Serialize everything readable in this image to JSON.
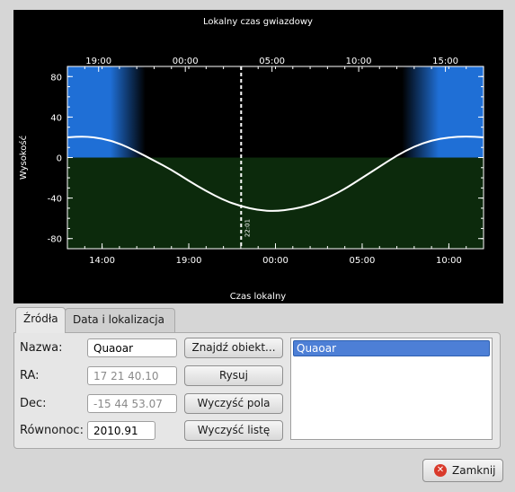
{
  "chart_data": {
    "type": "line",
    "title": "Lokalny czas gwiazdowy",
    "xlabel": "Czas lokalny",
    "ylabel": "Wysokość",
    "top_ticks": [
      "19:00",
      "00:00",
      "05:00",
      "10:00",
      "15:00"
    ],
    "bottom_ticks": [
      "14:00",
      "19:00",
      "00:00",
      "05:00",
      "10:00"
    ],
    "y_ticks": [
      "80",
      "40",
      "0",
      "-40",
      "-80"
    ],
    "ylim": [
      -90,
      90
    ],
    "xlim_hours": [
      12.0,
      36.0
    ],
    "series": [
      {
        "x": [
          "12:00",
          "13:00",
          "14:00",
          "15:00",
          "16:00",
          "17:00",
          "18:00",
          "19:00",
          "20:00",
          "21:00",
          "22:00",
          "23:00",
          "00:00",
          "01:00",
          "02:00",
          "03:00",
          "04:00",
          "05:00",
          "06:00",
          "07:00",
          "08:00",
          "09:00",
          "10:00",
          "11:00",
          "12:00"
        ],
        "y": [
          20,
          21,
          19,
          14,
          6,
          -3,
          -12,
          -23,
          -33,
          -42,
          -48,
          -52,
          -53,
          -51,
          -47,
          -40,
          -31,
          -20,
          -9,
          2,
          11,
          17,
          20,
          21,
          20
        ]
      }
    ],
    "current_time_label": "22:01",
    "current_time_hours": 22.02
  },
  "tabs": [
    {
      "label": "Źródła"
    },
    {
      "label": "Data i lokalizacja"
    }
  ],
  "form": {
    "name_label": "Nazwa:",
    "name_value": "Quaoar",
    "ra_label": "RA:",
    "ra_value": "17 21 40.10",
    "dec_label": "Dec:",
    "dec_value": "-15 44 53.07",
    "epoch_label": "Równonoc:",
    "epoch_value": "2010.91"
  },
  "buttons": {
    "find": "Znajdź obiekt...",
    "plot": "Rysuj",
    "clear_fields": "Wyczyść pola",
    "clear_list": "Wyczyść listę",
    "close": "Zamknij"
  },
  "object_list": [
    "Quaoar"
  ],
  "colors": {
    "sky_day": "#1f6fd6",
    "ground": "#0c2a0c",
    "curve": "#ffffff"
  }
}
